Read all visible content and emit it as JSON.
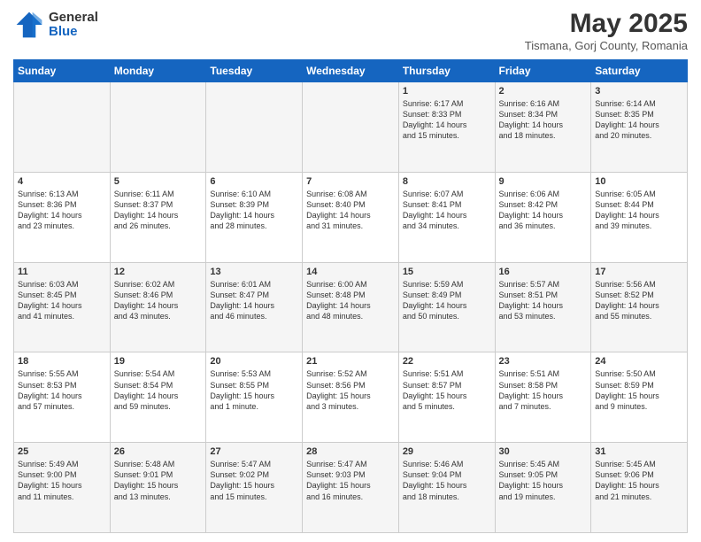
{
  "header": {
    "logo_general": "General",
    "logo_blue": "Blue",
    "month_title": "May 2025",
    "location": "Tismana, Gorj County, Romania"
  },
  "weekdays": [
    "Sunday",
    "Monday",
    "Tuesday",
    "Wednesday",
    "Thursday",
    "Friday",
    "Saturday"
  ],
  "weeks": [
    [
      {
        "day": "",
        "info": ""
      },
      {
        "day": "",
        "info": ""
      },
      {
        "day": "",
        "info": ""
      },
      {
        "day": "",
        "info": ""
      },
      {
        "day": "1",
        "info": "Sunrise: 6:17 AM\nSunset: 8:33 PM\nDaylight: 14 hours\nand 15 minutes."
      },
      {
        "day": "2",
        "info": "Sunrise: 6:16 AM\nSunset: 8:34 PM\nDaylight: 14 hours\nand 18 minutes."
      },
      {
        "day": "3",
        "info": "Sunrise: 6:14 AM\nSunset: 8:35 PM\nDaylight: 14 hours\nand 20 minutes."
      }
    ],
    [
      {
        "day": "4",
        "info": "Sunrise: 6:13 AM\nSunset: 8:36 PM\nDaylight: 14 hours\nand 23 minutes."
      },
      {
        "day": "5",
        "info": "Sunrise: 6:11 AM\nSunset: 8:37 PM\nDaylight: 14 hours\nand 26 minutes."
      },
      {
        "day": "6",
        "info": "Sunrise: 6:10 AM\nSunset: 8:39 PM\nDaylight: 14 hours\nand 28 minutes."
      },
      {
        "day": "7",
        "info": "Sunrise: 6:08 AM\nSunset: 8:40 PM\nDaylight: 14 hours\nand 31 minutes."
      },
      {
        "day": "8",
        "info": "Sunrise: 6:07 AM\nSunset: 8:41 PM\nDaylight: 14 hours\nand 34 minutes."
      },
      {
        "day": "9",
        "info": "Sunrise: 6:06 AM\nSunset: 8:42 PM\nDaylight: 14 hours\nand 36 minutes."
      },
      {
        "day": "10",
        "info": "Sunrise: 6:05 AM\nSunset: 8:44 PM\nDaylight: 14 hours\nand 39 minutes."
      }
    ],
    [
      {
        "day": "11",
        "info": "Sunrise: 6:03 AM\nSunset: 8:45 PM\nDaylight: 14 hours\nand 41 minutes."
      },
      {
        "day": "12",
        "info": "Sunrise: 6:02 AM\nSunset: 8:46 PM\nDaylight: 14 hours\nand 43 minutes."
      },
      {
        "day": "13",
        "info": "Sunrise: 6:01 AM\nSunset: 8:47 PM\nDaylight: 14 hours\nand 46 minutes."
      },
      {
        "day": "14",
        "info": "Sunrise: 6:00 AM\nSunset: 8:48 PM\nDaylight: 14 hours\nand 48 minutes."
      },
      {
        "day": "15",
        "info": "Sunrise: 5:59 AM\nSunset: 8:49 PM\nDaylight: 14 hours\nand 50 minutes."
      },
      {
        "day": "16",
        "info": "Sunrise: 5:57 AM\nSunset: 8:51 PM\nDaylight: 14 hours\nand 53 minutes."
      },
      {
        "day": "17",
        "info": "Sunrise: 5:56 AM\nSunset: 8:52 PM\nDaylight: 14 hours\nand 55 minutes."
      }
    ],
    [
      {
        "day": "18",
        "info": "Sunrise: 5:55 AM\nSunset: 8:53 PM\nDaylight: 14 hours\nand 57 minutes."
      },
      {
        "day": "19",
        "info": "Sunrise: 5:54 AM\nSunset: 8:54 PM\nDaylight: 14 hours\nand 59 minutes."
      },
      {
        "day": "20",
        "info": "Sunrise: 5:53 AM\nSunset: 8:55 PM\nDaylight: 15 hours\nand 1 minute."
      },
      {
        "day": "21",
        "info": "Sunrise: 5:52 AM\nSunset: 8:56 PM\nDaylight: 15 hours\nand 3 minutes."
      },
      {
        "day": "22",
        "info": "Sunrise: 5:51 AM\nSunset: 8:57 PM\nDaylight: 15 hours\nand 5 minutes."
      },
      {
        "day": "23",
        "info": "Sunrise: 5:51 AM\nSunset: 8:58 PM\nDaylight: 15 hours\nand 7 minutes."
      },
      {
        "day": "24",
        "info": "Sunrise: 5:50 AM\nSunset: 8:59 PM\nDaylight: 15 hours\nand 9 minutes."
      }
    ],
    [
      {
        "day": "25",
        "info": "Sunrise: 5:49 AM\nSunset: 9:00 PM\nDaylight: 15 hours\nand 11 minutes."
      },
      {
        "day": "26",
        "info": "Sunrise: 5:48 AM\nSunset: 9:01 PM\nDaylight: 15 hours\nand 13 minutes."
      },
      {
        "day": "27",
        "info": "Sunrise: 5:47 AM\nSunset: 9:02 PM\nDaylight: 15 hours\nand 15 minutes."
      },
      {
        "day": "28",
        "info": "Sunrise: 5:47 AM\nSunset: 9:03 PM\nDaylight: 15 hours\nand 16 minutes."
      },
      {
        "day": "29",
        "info": "Sunrise: 5:46 AM\nSunset: 9:04 PM\nDaylight: 15 hours\nand 18 minutes."
      },
      {
        "day": "30",
        "info": "Sunrise: 5:45 AM\nSunset: 9:05 PM\nDaylight: 15 hours\nand 19 minutes."
      },
      {
        "day": "31",
        "info": "Sunrise: 5:45 AM\nSunset: 9:06 PM\nDaylight: 15 hours\nand 21 minutes."
      }
    ]
  ]
}
